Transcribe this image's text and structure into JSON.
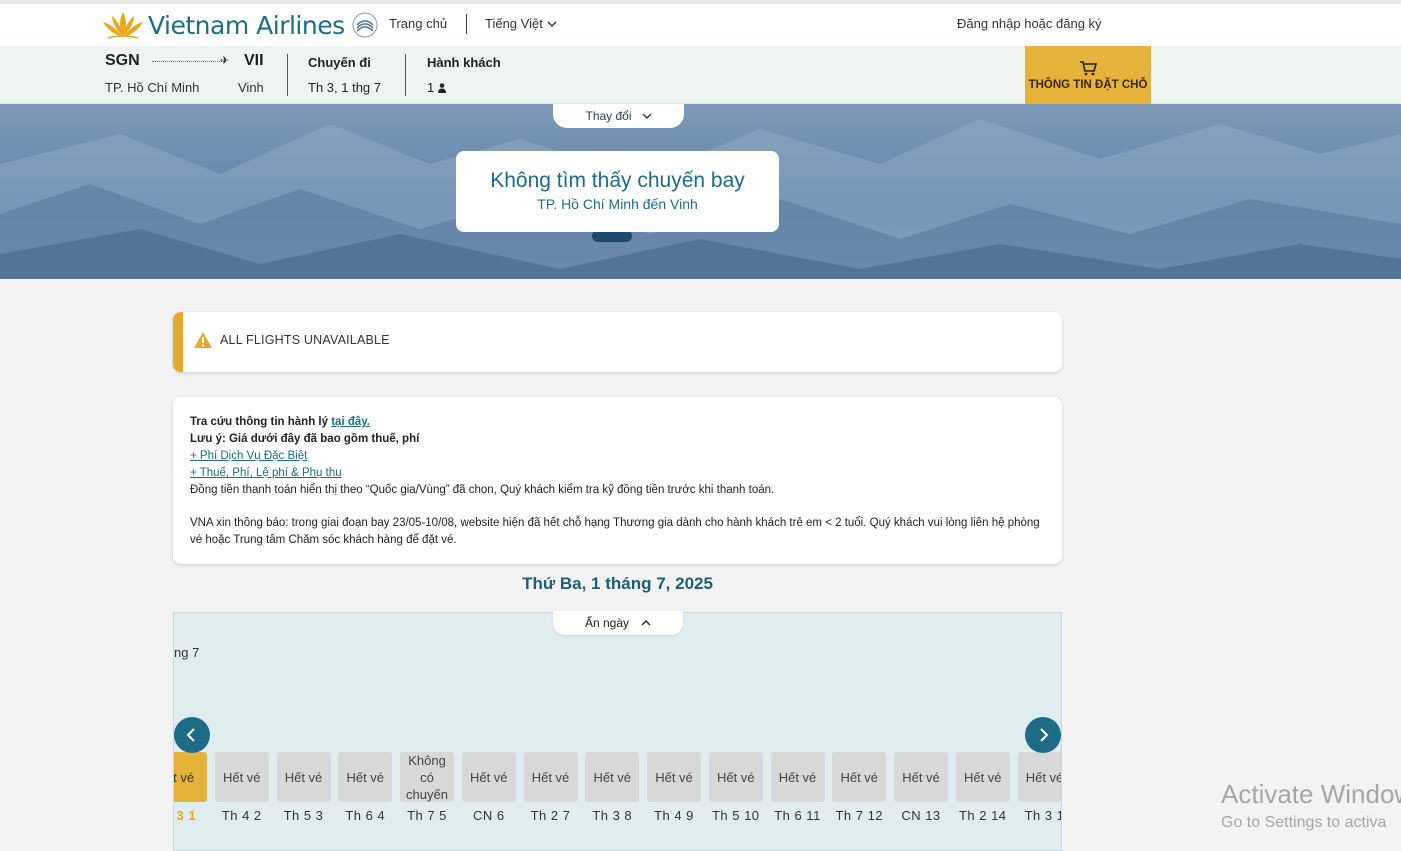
{
  "header": {
    "brand": "Vietnam Airlines",
    "nav_home": "Trang chủ",
    "nav_language": "Tiếng Việt",
    "nav_login": "Đăng nhập hoặc đăng ký"
  },
  "summary": {
    "origin_code": "SGN",
    "origin_city": "TP. Hồ Chí Minh",
    "dest_code": "VII",
    "dest_city": "Vinh",
    "trip_label": "Chuyến đi",
    "trip_date": "Th 3, 1 thg 7",
    "pax_label": "Hành khách",
    "pax_count": "1",
    "booking_button": "THÔNG TIN ĐẶT CHỖ"
  },
  "hero": {
    "change_label": "Thay đổi",
    "title": "Không tìm thấy chuyến bay",
    "subtitle": "TP. Hồ Chí Minh đến Vinh"
  },
  "alert": {
    "text": "ALL FLIGHTS UNAVAILABLE"
  },
  "info": {
    "line1_prefix": "Tra cứu thông tin hành lý ",
    "line1_link": "tại đây.",
    "line2": "Lưu ý: Giá dưới đây đã bao gồm thuế, phí",
    "link_special": "+ Phí Dịch Vụ Đặc Biệt",
    "link_taxes": "+ Thuế, Phí, Lệ phí & Phụ thu",
    "line_currency": "Đồng tiền thanh toán hiển thị theo “Quốc gia/Vùng” đã chọn, Quý khách kiểm tra kỹ đồng tiền trước khi thanh toán.",
    "notice": "VNA xin thông báo: trong giai đoạn bay 23/05-10/08, website hiện đã hết chỗ hạng Thương gia dành cho hành khách trẻ em < 2 tuổi. Quý khách vui lòng liên hệ phòng vé hoặc Trung tâm Chăm sóc khách hàng để đặt vé."
  },
  "calendar": {
    "date_title": "Thứ Ba, 1 tháng 7, 2025",
    "hide_label": "Ẩn ngày",
    "month_label": "ng 7",
    "days": [
      {
        "status": "ết vé",
        "label": "h 3 1",
        "selected": true
      },
      {
        "status": "Hết vé",
        "label": "Th 4 2",
        "selected": false
      },
      {
        "status": "Hết vé",
        "label": "Th 5 3",
        "selected": false
      },
      {
        "status": "Hết vé",
        "label": "Th 6 4",
        "selected": false
      },
      {
        "status": "Không có chuyến",
        "label": "Th 7 5",
        "selected": false
      },
      {
        "status": "Hết vé",
        "label": "CN 6",
        "selected": false
      },
      {
        "status": "Hết vé",
        "label": "Th 2 7",
        "selected": false
      },
      {
        "status": "Hết vé",
        "label": "Th 3 8",
        "selected": false
      },
      {
        "status": "Hết vé",
        "label": "Th 4 9",
        "selected": false
      },
      {
        "status": "Hết vé",
        "label": "Th 5 10",
        "selected": false
      },
      {
        "status": "Hết vé",
        "label": "Th 6 11",
        "selected": false
      },
      {
        "status": "Hết vé",
        "label": "Th 7 12",
        "selected": false
      },
      {
        "status": "Hết vé",
        "label": "CN 13",
        "selected": false
      },
      {
        "status": "Hết vé",
        "label": "Th 2 14",
        "selected": false
      },
      {
        "status": "Hết vé",
        "label": "Th 3 1",
        "selected": false
      }
    ]
  },
  "watermark": {
    "title": "Activate Window",
    "subtitle": "Go to Settings to activa"
  },
  "colors": {
    "brand_teal": "#1d6b87",
    "accent_gold": "#e6b33a",
    "alert_orange": "#e9a82c"
  }
}
